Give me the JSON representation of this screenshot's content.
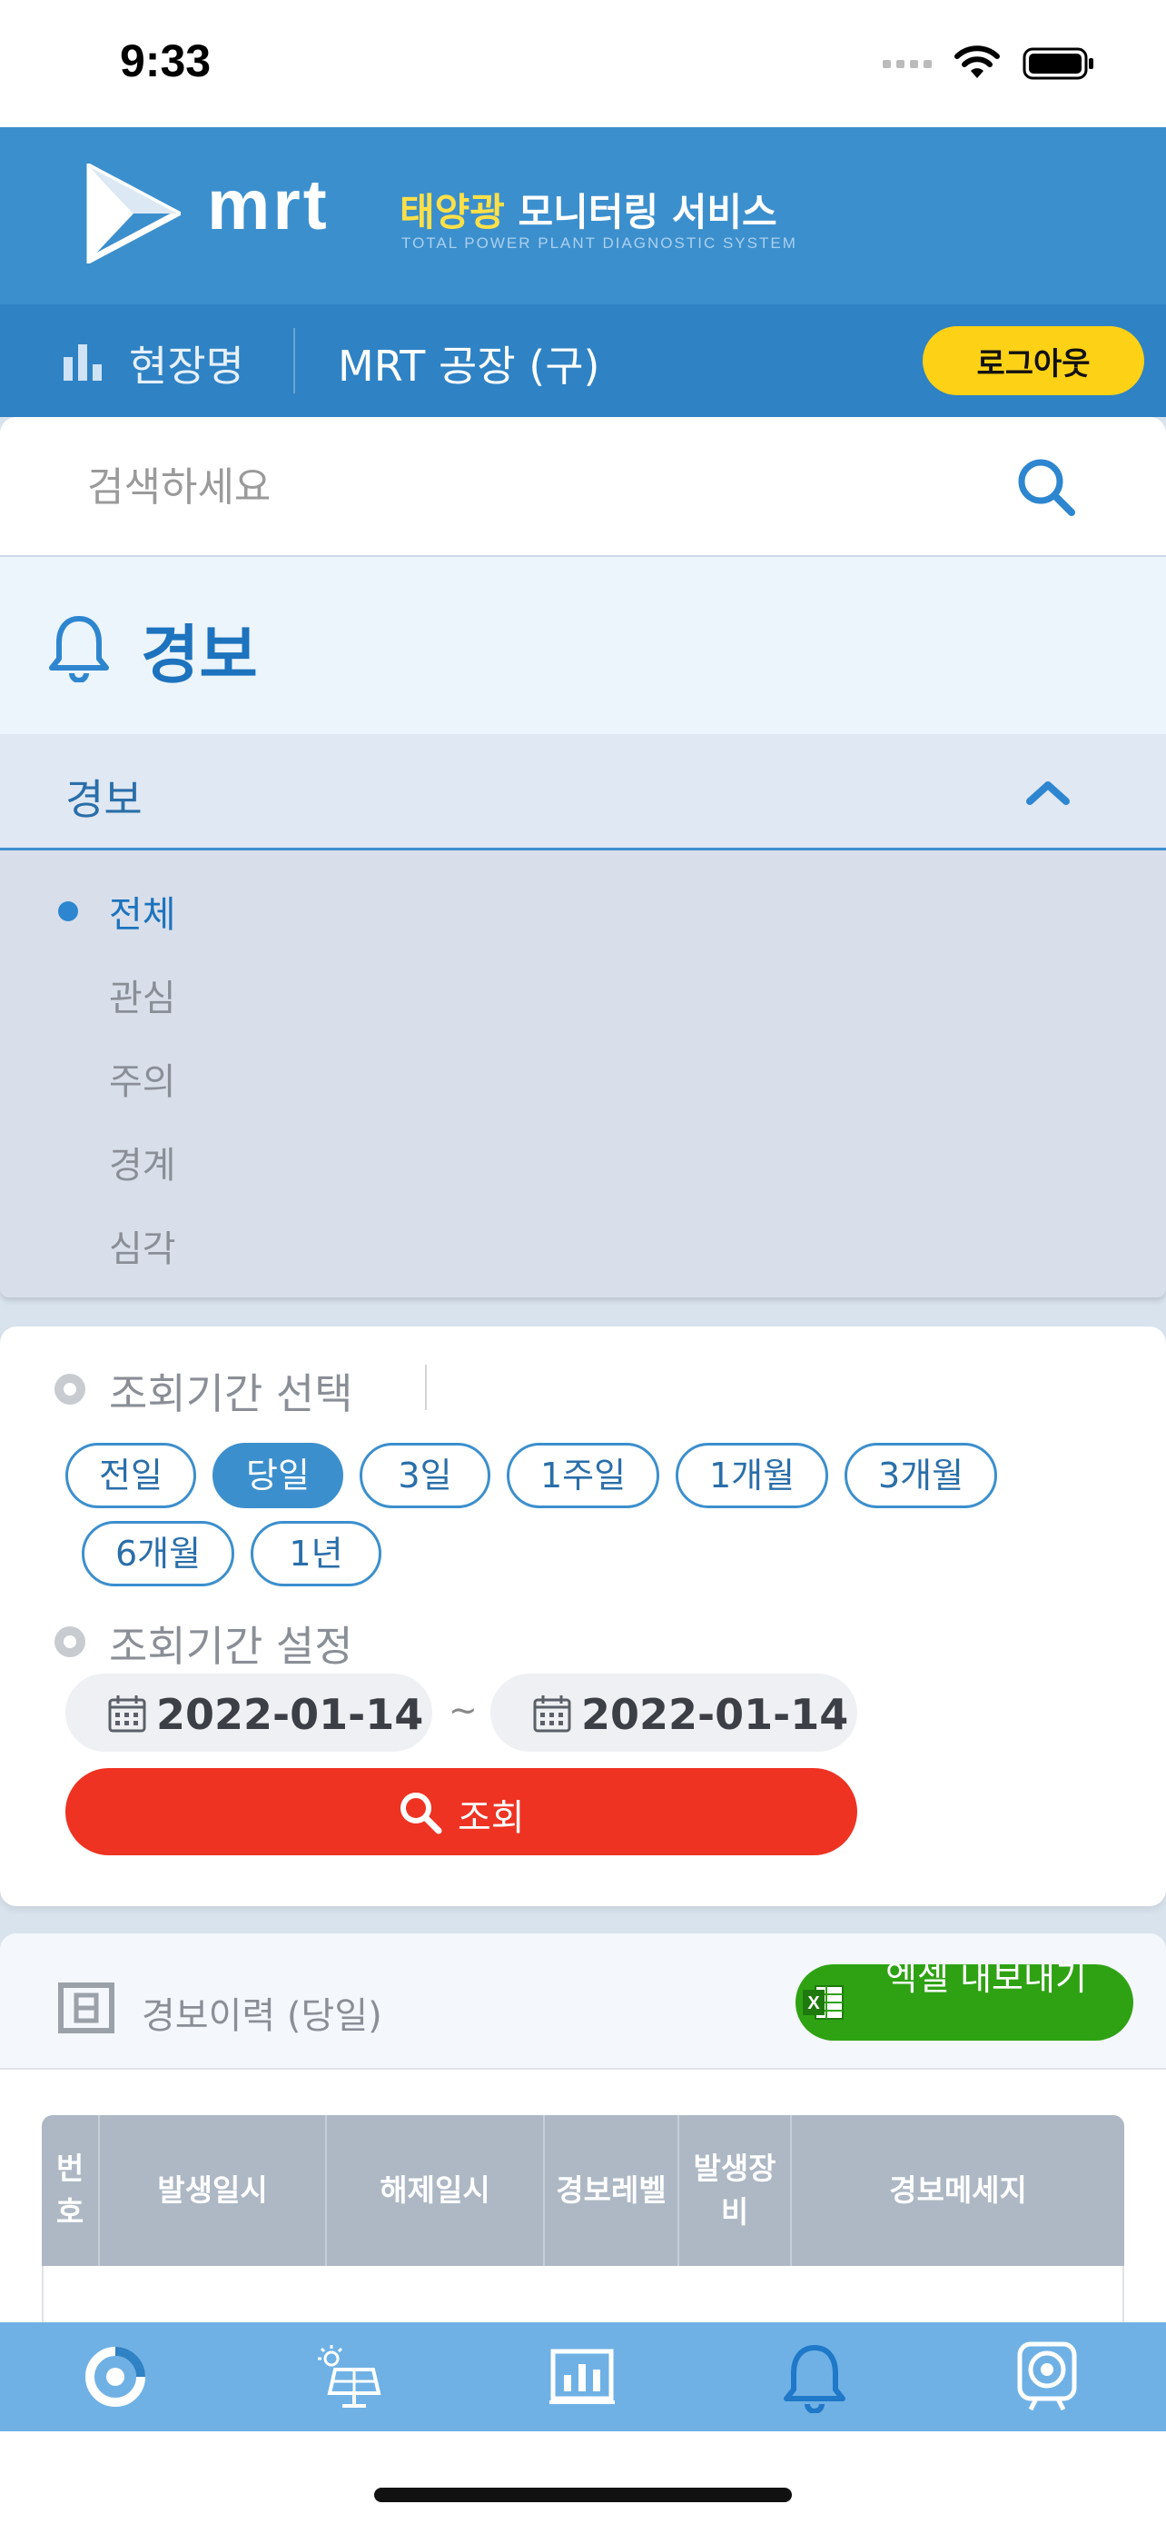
{
  "status_bar": {
    "time": "9:33"
  },
  "header": {
    "logo_text": "mrt",
    "service_title_accent": "태양광",
    "service_title_rest": " 모니터링 서비스",
    "service_subtitle": "TOTAL POWER PLANT DIAGNOSTIC SYSTEM",
    "site_label": "현장명",
    "site_name": "MRT 공장 (구)",
    "logout_label": "로그아웃"
  },
  "search": {
    "placeholder": "검색하세요"
  },
  "section": {
    "title": "경보"
  },
  "filter": {
    "header_label": "경보",
    "levels": [
      "전체",
      "관심",
      "주의",
      "경계",
      "심각"
    ],
    "active_level": "전체"
  },
  "period": {
    "select_label": "조회기간 선택",
    "chips": [
      "전일",
      "당일",
      "3일",
      "1주일",
      "1개월",
      "3개월",
      "6개월",
      "1년"
    ],
    "active_chip": "당일",
    "set_label": "조회기간 설정",
    "start_date": "2022-01-14",
    "end_date": "2022-01-14",
    "tilde": "~",
    "query_label": "조회"
  },
  "history": {
    "title": "경보이력 (당일)",
    "excel_label": "엑셀 내보내기",
    "columns": [
      "번호",
      "발생일시",
      "해제일시",
      "경보레벨",
      "발생장비",
      "경보메세지"
    ]
  },
  "colors": {
    "header_bg": "#3c8fcd",
    "subheader_bg": "#2f82c3",
    "logout_bg": "#fcd116",
    "query_btn": "#ee3322",
    "excel_btn": "#2fa214",
    "nav_bg": "#6fb1e5",
    "active_nav": "#1f78c8"
  },
  "nav": {
    "items": [
      "dashboard-icon",
      "solar-panel-icon",
      "chart-icon",
      "bell-icon",
      "camera-icon"
    ],
    "active": "bell-icon"
  }
}
